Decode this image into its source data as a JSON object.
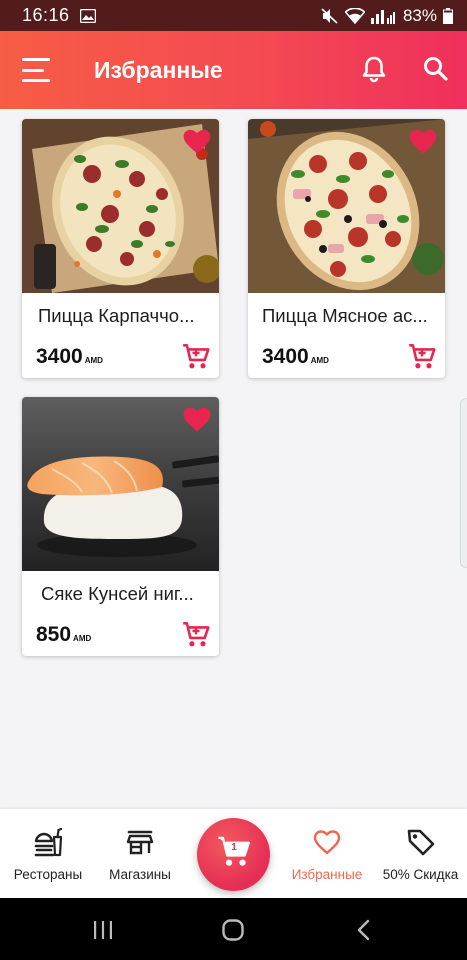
{
  "status_bar": {
    "time": "16:16",
    "battery": "83%"
  },
  "header": {
    "title": "Избранные"
  },
  "products": [
    {
      "name": "Пицца Карпаччо...",
      "price": "3400",
      "currency": "AMD",
      "image": "pizza-carpaccio",
      "favorite": true
    },
    {
      "name": "Пицца Мясное ас...",
      "price": "3400",
      "currency": "AMD",
      "image": "pizza-meat",
      "favorite": true
    },
    {
      "name": "Сяке Кунсей ниг...",
      "price": "850",
      "currency": "AMD",
      "image": "salmon-nigiri",
      "favorite": true
    }
  ],
  "bottom_nav": {
    "items": [
      {
        "label": "Рестораны",
        "icon": "restaurant-icon"
      },
      {
        "label": "Магазины",
        "icon": "store-icon"
      },
      {
        "label": "Избранные",
        "icon": "heart-icon",
        "active": true
      },
      {
        "label": "50% Скидка",
        "icon": "tag-icon"
      }
    ],
    "cart_count": "1"
  },
  "colors": {
    "accent": "#f0674d",
    "heart": "#e8254f",
    "cart": "#e8254f",
    "header_start": "#f65d45",
    "header_end": "#ef2f5c"
  }
}
